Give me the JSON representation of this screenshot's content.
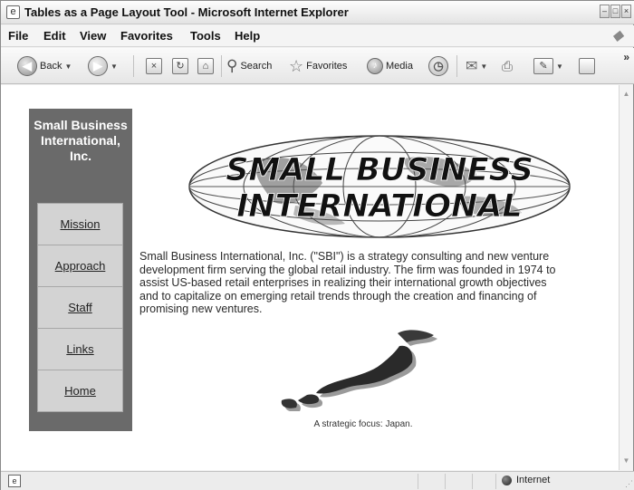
{
  "window": {
    "title": "Tables as a Page Layout Tool - Microsoft Internet Explorer",
    "app_icon": "ie-page-icon",
    "controls": [
      "minimize",
      "maximize",
      "close"
    ]
  },
  "menu": {
    "items": [
      "File",
      "Edit",
      "View",
      "Favorites",
      "Tools",
      "Help"
    ]
  },
  "toolbar": {
    "back_label": "Back",
    "search_label": "Search",
    "favorites_label": "Favorites",
    "media_label": "Media",
    "overflow": "»"
  },
  "page": {
    "sidebar_title": "Small Business International, Inc.",
    "nav": [
      "Mission",
      "Approach",
      "Staff",
      "Links",
      "Home"
    ],
    "logo_line1": "SMALL BUSINESS",
    "logo_line2": "INTERNATIONAL",
    "intro": "Small Business International, Inc. (\"SBI\") is a strategy consulting and new venture development firm serving the global retail industry. The firm was founded in 1974 to assist US-based retail enterprises in realizing their international growth objectives and to capitalize on emerging retail trends through the creation and financing of promising new ventures.",
    "caption": "A strategic focus: Japan."
  },
  "status": {
    "zone": "Internet"
  }
}
